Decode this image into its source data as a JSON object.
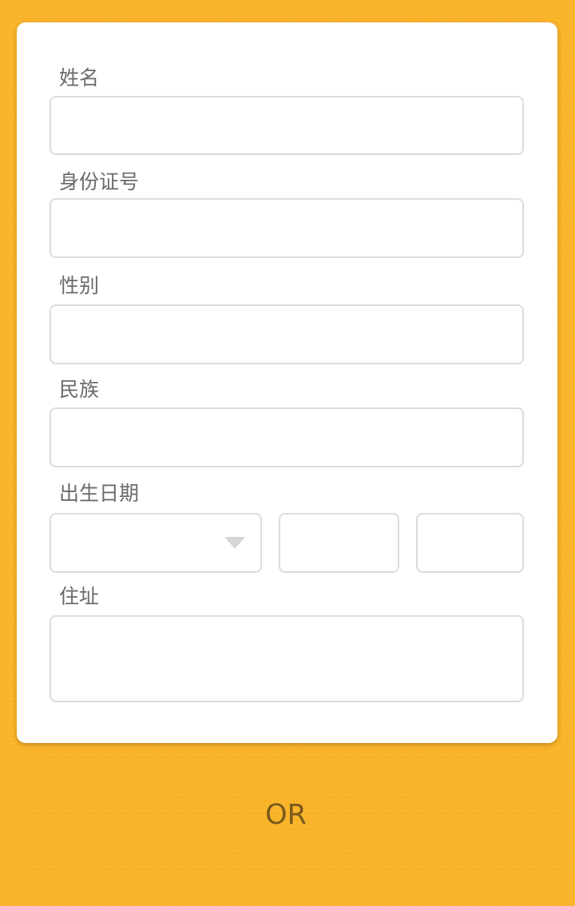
{
  "form": {
    "name": {
      "label": "姓名",
      "value": ""
    },
    "id_number": {
      "label": "身份证号",
      "value": ""
    },
    "gender": {
      "label": "性别",
      "value": ""
    },
    "ethnicity": {
      "label": "民族",
      "value": ""
    },
    "birth_date": {
      "label": "出生日期",
      "year_selected": "",
      "month_value": "",
      "day_value": ""
    },
    "address": {
      "label": "住址",
      "value": ""
    }
  },
  "divider": {
    "text": "OR"
  },
  "colors": {
    "background": "#fbb52b",
    "card": "#ffffff",
    "label_text": "#6b6b6b",
    "field_border": "#dcdcdc",
    "or_text": "#7a5a1c"
  },
  "icons": {
    "select_caret": "chevron-down-icon"
  }
}
